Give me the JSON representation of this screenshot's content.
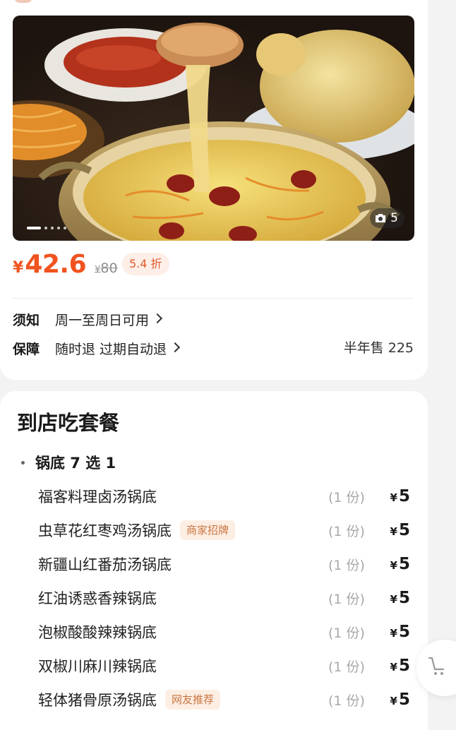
{
  "hero": {
    "photo_count": "5",
    "carousel_total": 5,
    "carousel_active": 0
  },
  "price": {
    "currency": "¥",
    "current": "42.6",
    "original_currency": "¥",
    "original": "80",
    "discount": "5.4 折"
  },
  "info": {
    "notice_label": "须知",
    "notice_value": "周一至周日可用",
    "guarantee_label": "保障",
    "guarantee_value": "随时退 过期自动退",
    "sold": "半年售 225"
  },
  "menu": {
    "title": "到店吃套餐",
    "group": "锅底 7 选 1",
    "items": [
      {
        "name": "福客料理卤汤锅底",
        "tag": "",
        "qty": "(1 份)",
        "currency": "¥",
        "price": "5"
      },
      {
        "name": "虫草花红枣鸡汤锅底",
        "tag": "商家招牌",
        "qty": "(1 份)",
        "currency": "¥",
        "price": "5"
      },
      {
        "name": "新疆山红番茄汤锅底",
        "tag": "",
        "qty": "(1 份)",
        "currency": "¥",
        "price": "5"
      },
      {
        "name": "红油诱惑香辣锅底",
        "tag": "",
        "qty": "(1 份)",
        "currency": "¥",
        "price": "5"
      },
      {
        "name": "泡椒酸酸辣辣锅底",
        "tag": "",
        "qty": "(1 份)",
        "currency": "¥",
        "price": "5"
      },
      {
        "name": "双椒川麻川辣锅底",
        "tag": "",
        "qty": "(1 份)",
        "currency": "¥",
        "price": "5"
      },
      {
        "name": "轻体猪骨原汤锅底",
        "tag": "网友推荐",
        "qty": "(1 份)",
        "currency": "¥",
        "price": "5"
      }
    ]
  },
  "icons": {
    "photo": "camera-icon",
    "cart": "cart-icon",
    "chevron": "chevron-right-icon"
  },
  "colors": {
    "accent": "#f0531f",
    "tag_bg": "#fdeee4",
    "tag_text": "#c9753f"
  }
}
